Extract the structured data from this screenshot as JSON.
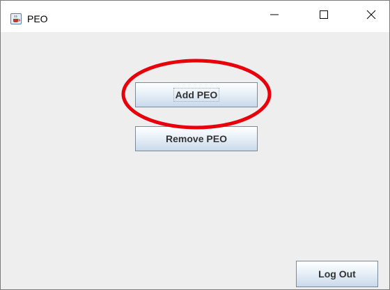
{
  "window": {
    "title": "PEO",
    "app_icon": "java-cup-icon",
    "controls": {
      "minimize_icon": "minimize-icon",
      "maximize_icon": "maximize-icon",
      "close_icon": "close-icon"
    }
  },
  "main": {
    "add_label": "Add PEO",
    "remove_label": "Remove PEO",
    "logout_label": "Log Out"
  },
  "annotation": {
    "shape": "ellipse",
    "color": "#e8000b",
    "target": "add-peo-button"
  },
  "colors": {
    "window_bg": "#eeeeee",
    "titlebar_bg": "#ffffff",
    "button_text": "#333333",
    "annotation": "#e8000b"
  }
}
